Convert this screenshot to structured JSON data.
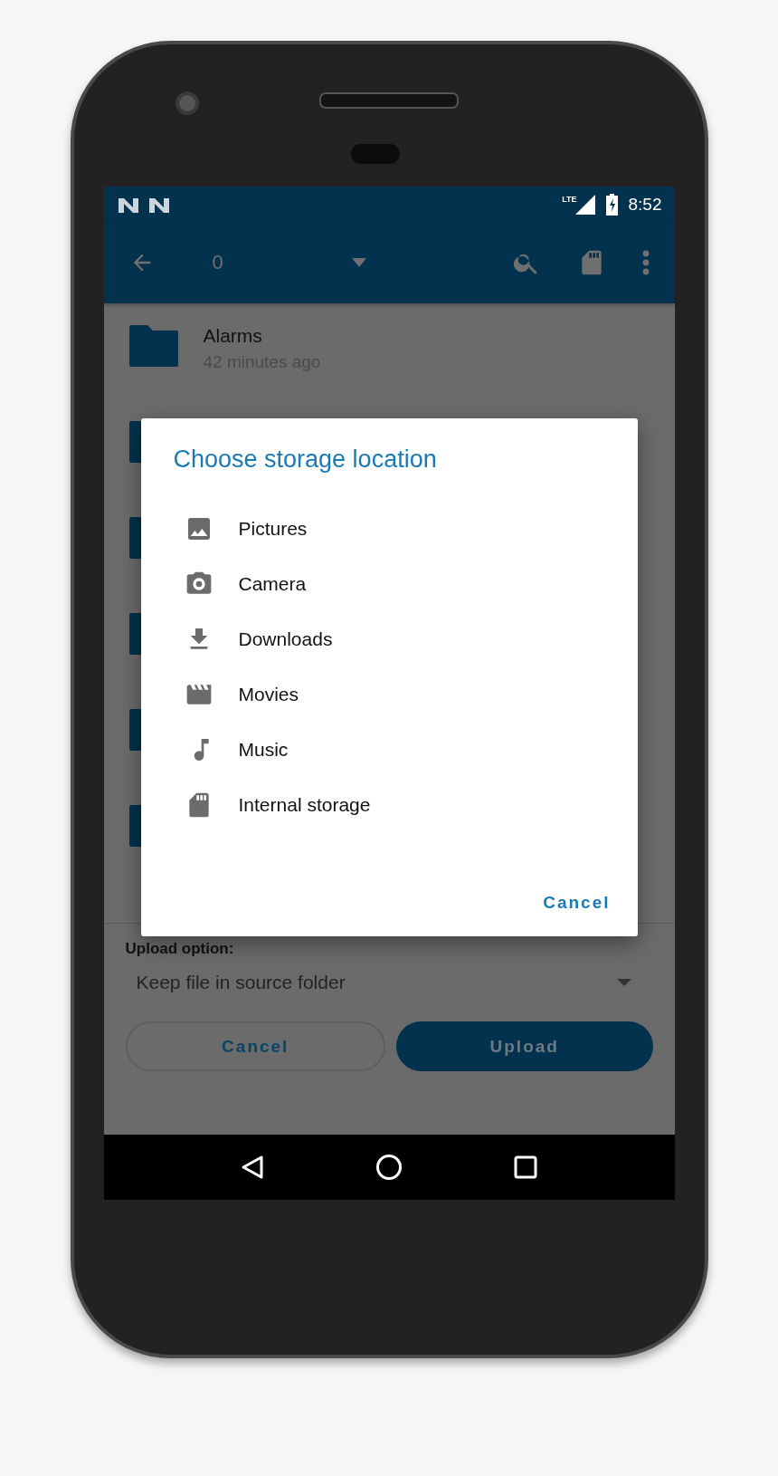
{
  "status_bar": {
    "network": "LTE",
    "time": "8:52"
  },
  "app_bar": {
    "title": "0"
  },
  "files": [
    {
      "name": "Alarms",
      "modified": "42 minutes ago"
    }
  ],
  "dialog": {
    "title": "Choose storage location",
    "options": [
      {
        "label": "Pictures",
        "kind": "pictures"
      },
      {
        "label": "Camera",
        "kind": "camera"
      },
      {
        "label": "Downloads",
        "kind": "downloads"
      },
      {
        "label": "Movies",
        "kind": "movies"
      },
      {
        "label": "Music",
        "kind": "music"
      },
      {
        "label": "Internal storage",
        "kind": "storage"
      }
    ],
    "cancel": "Cancel"
  },
  "upload_option": {
    "label": "Upload option:",
    "value": "Keep file in source folder"
  },
  "buttons": [
    {
      "label": "Cancel",
      "kind": "outline"
    },
    {
      "label": "Upload",
      "kind": "filled"
    }
  ]
}
